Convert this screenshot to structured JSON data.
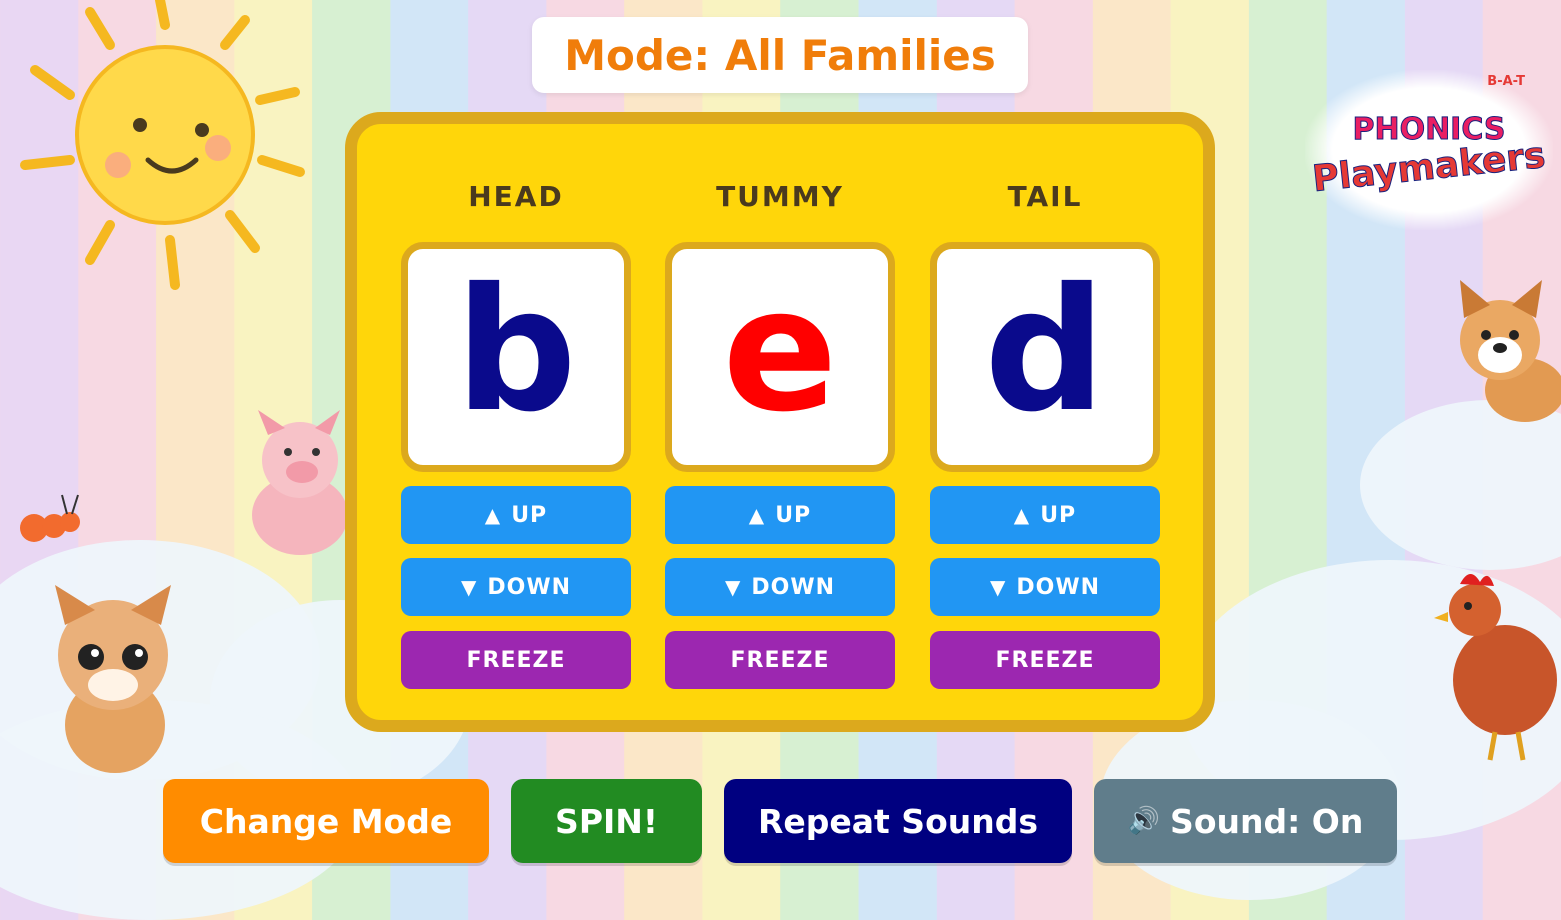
{
  "header": {
    "mode_text": "Mode: All Families"
  },
  "logo": {
    "tag": "B-A-T",
    "line1": "PHONICS",
    "line2": "Playmakers"
  },
  "columns": [
    {
      "label": "HEAD",
      "letter": "b",
      "letter_color": "#0a0a8c",
      "up": "UP",
      "down": "DOWN",
      "freeze": "FREEZE"
    },
    {
      "label": "TUMMY",
      "letter": "e",
      "letter_color": "#ff0000",
      "up": "UP",
      "down": "DOWN",
      "freeze": "FREEZE"
    },
    {
      "label": "TAIL",
      "letter": "d",
      "letter_color": "#0a0a8c",
      "up": "UP",
      "down": "DOWN",
      "freeze": "FREEZE"
    }
  ],
  "arrows": {
    "up": "▲",
    "down": "▼"
  },
  "controls": {
    "change_mode": "Change Mode",
    "spin": "SPIN!",
    "repeat_sounds": "Repeat Sounds",
    "sound_icon": "🔊",
    "sound": "Sound: On"
  },
  "colors": {
    "mode_text": "#f07d0a",
    "board": "#ffd60a",
    "board_border": "#dca91d",
    "up_down_button": "#2196f3",
    "freeze_button": "#9c27b0",
    "change_mode": "#ff8c00",
    "spin": "#228b22",
    "repeat_sounds": "#000080",
    "sound": "#607d8b"
  }
}
